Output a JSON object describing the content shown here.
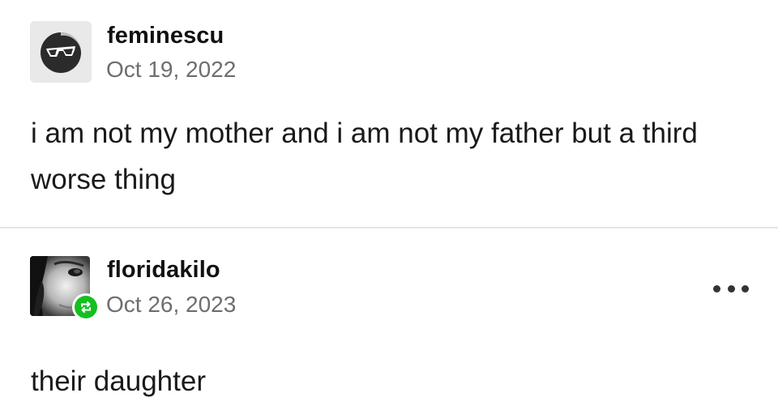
{
  "posts": [
    {
      "username": "feminescu",
      "date": "Oct 19, 2022",
      "avatar_icon": "sunglasses-icon",
      "text": "i am not my mother and i am not my father but a third worse thing"
    },
    {
      "username": "floridakilo",
      "date": "Oct 26, 2023",
      "avatar_icon": "face-photo-avatar",
      "badge_icon": "reblog-icon",
      "badge_color": "#14c01f",
      "menu_icon": "more-options-icon",
      "text": "their daughter"
    }
  ]
}
